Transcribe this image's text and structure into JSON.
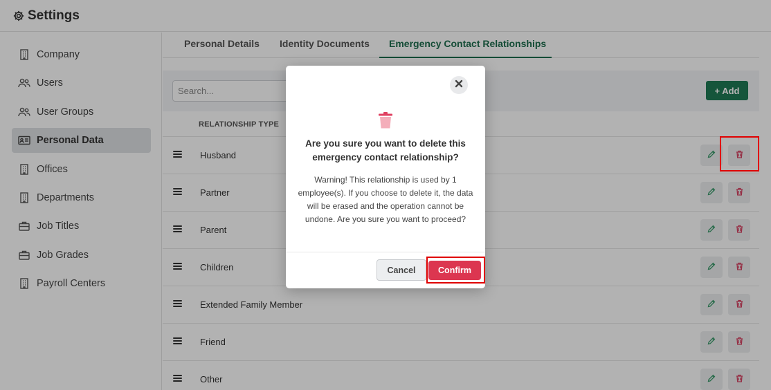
{
  "header": {
    "title": "Settings",
    "icon": "gear-icon"
  },
  "sidebar": {
    "items": [
      {
        "label": "Company",
        "icon": "building-icon",
        "active": false
      },
      {
        "label": "Users",
        "icon": "users-icon",
        "active": false
      },
      {
        "label": "User Groups",
        "icon": "users-icon",
        "active": false
      },
      {
        "label": "Personal Data",
        "icon": "id-card-icon",
        "active": true
      },
      {
        "label": "Offices",
        "icon": "building-icon",
        "active": false
      },
      {
        "label": "Departments",
        "icon": "building-icon",
        "active": false
      },
      {
        "label": "Job Titles",
        "icon": "briefcase-icon",
        "active": false
      },
      {
        "label": "Job Grades",
        "icon": "briefcase-icon",
        "active": false
      },
      {
        "label": "Payroll Centers",
        "icon": "building-icon",
        "active": false
      }
    ]
  },
  "tabs": [
    {
      "label": "Personal Details",
      "active": false
    },
    {
      "label": "Identity Documents",
      "active": false
    },
    {
      "label": "Emergency Contact Relationships",
      "active": true
    }
  ],
  "toolbar": {
    "search_placeholder": "Search...",
    "add_label": "+ Add"
  },
  "table": {
    "column_header": "RELATIONSHIP TYPE",
    "rows": [
      "Husband",
      "Partner",
      "Parent",
      "Children",
      "Extended Family Member",
      "Friend",
      "Other"
    ]
  },
  "modal": {
    "title": "Are you sure you want to delete this emergency contact relationship?",
    "body": "Warning! This relationship is used by 1 employee(s). If you choose to delete it, the data will be erased and the operation cannot be undone. Are you sure you want to proceed?",
    "cancel_label": "Cancel",
    "confirm_label": "Confirm"
  },
  "colors": {
    "accent_green": "#1f7a55",
    "tab_active": "#1e6e4e",
    "danger": "#dc3650",
    "highlight": "#e00000",
    "edit_icon": "#3a9a6a",
    "delete_icon": "#d64060"
  }
}
